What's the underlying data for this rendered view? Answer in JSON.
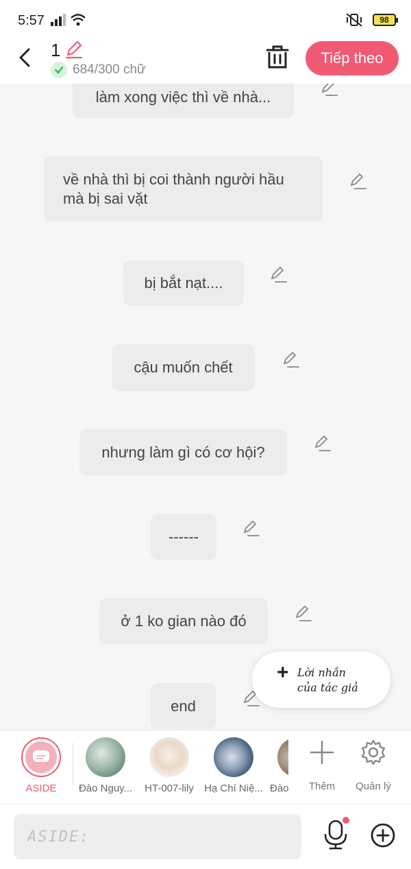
{
  "status": {
    "time": "5:57",
    "battery": "98"
  },
  "header": {
    "chapter_number": "1",
    "word_count": "684/300 chữ",
    "next_label": "Tiếp theo"
  },
  "messages": [
    {
      "text": "làm xong việc thì về nhà..."
    },
    {
      "text": "về nhà thì bị coi thành người hầu mà bị sai vặt"
    },
    {
      "text": "bị bắt nạt...."
    },
    {
      "text": "cậu muốn chết"
    },
    {
      "text": "nhưng làm gì có cơ hội?"
    },
    {
      "text": "------"
    },
    {
      "text": "ở 1 ko gian nào đó"
    },
    {
      "text": "end"
    }
  ],
  "author_note": {
    "line1": "Lời nhắn",
    "line2": "của tác giả"
  },
  "characters": [
    {
      "name": "ASIDE"
    },
    {
      "name": "Đào Nguy..."
    },
    {
      "name": "HT-007-lily"
    },
    {
      "name": "Hạ Chí Niệ..."
    },
    {
      "name": "Đào"
    }
  ],
  "tools": {
    "add_label": "Thêm",
    "manage_label": "Quản lý"
  },
  "input": {
    "placeholder": "ASIDE:"
  },
  "colors": {
    "accent": "#f25a73",
    "bubble": "#ececec",
    "background": "#f6f6f6"
  }
}
